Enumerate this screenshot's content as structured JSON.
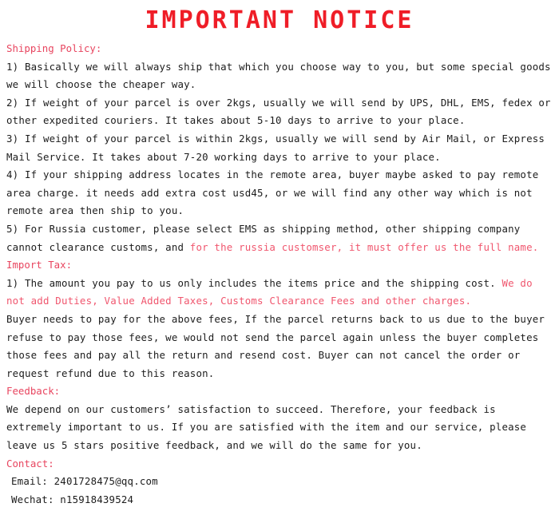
{
  "document": {
    "title": "IMPORTANT NOTICE",
    "colors": {
      "title_red": "#ef1d27",
      "heading_red": "#e8455f",
      "emphasis_red": "#f0566e",
      "body_black": "#1c1c1c",
      "background": "#ffffff"
    }
  },
  "shipping": {
    "heading": "Shipping Policy:",
    "item1": "1) Basically we will always ship that which you choose way to you, but some special goods we will choose the cheaper way.",
    "item2": "2) If weight of your parcel is over 2kgs, usually we will send by UPS, DHL, EMS, fedex or other expedited couriers. It takes about 5-10 days to arrive to your place.",
    "item3": "3) If weight of your parcel is within 2kgs, usually we will send by Air Mail, or Express Mail Service. It takes about 7-20 working days to arrive to your place.",
    "item4": "4) If your shipping address locates in the remote area, buyer maybe asked to pay remote area charge. it needs add extra cost usd45, or we will find any other way which is not remote area then ship to you.",
    "item5_black": "5) For Russia customer, please select EMS as shipping method, other shipping company cannot clearance customs, and ",
    "item5_red": "for the russia customser, it must offer us the full name."
  },
  "import_tax": {
    "heading": "Import Tax:",
    "item1_black": "1) The amount you pay to us only includes the items price and the shipping cost. ",
    "item1_red": "We do not add Duties, Value Added Taxes, Customs Clearance Fees and other charges.",
    "paragraph": "Buyer needs to pay for the above fees, If the parcel returns back to us due to the buyer refuse to pay those fees, we would not send the parcel again unless the buyer completes those fees and pay all the return and resend cost. Buyer can not cancel the order or request refund due to this reason."
  },
  "feedback": {
    "heading": "Feedback:",
    "paragraph": "We depend on our customers’ satisfaction to succeed. Therefore, your feedback is extremely important to us. If you are satisfied with the item and our service, please leave us 5 stars positive feedback, and we will do the same for you."
  },
  "contact": {
    "heading": "Contact:",
    "email": "Email: 2401728475@qq.com",
    "wechat": "Wechat: n15918439524"
  }
}
